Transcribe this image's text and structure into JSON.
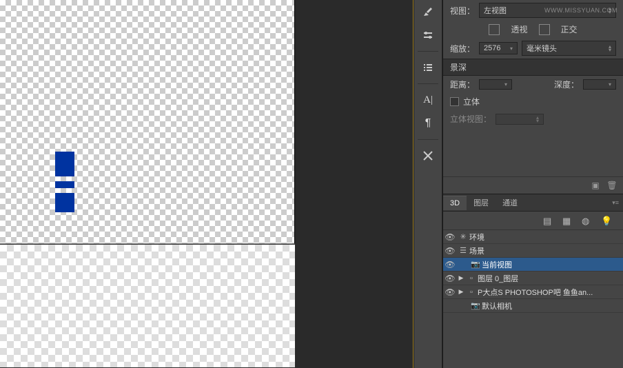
{
  "watermark": "WWW.MISSYUAN.COM",
  "props": {
    "view_label": "视图：",
    "view_value": "左视图",
    "persp_label": "透视",
    "ortho_label": "正交",
    "zoom_label": "缩放：",
    "zoom_value": "2576",
    "lens_value": "毫米镜头",
    "dof_header": "景深",
    "distance_label": "距离：",
    "depth_label": "深度：",
    "stereo_check_label": "立体",
    "stereo_view_label": "立体视图："
  },
  "tabs": {
    "t3d": "3D",
    "layers": "图层",
    "channels": "通道"
  },
  "tree": {
    "env": "环境",
    "scene": "场景",
    "current_view": "当前视图",
    "layer0": "图层 0_图层",
    "pbig": "P大点S PHOTOSHOP吧 鱼鱼an...",
    "default_camera": "默认相机"
  }
}
